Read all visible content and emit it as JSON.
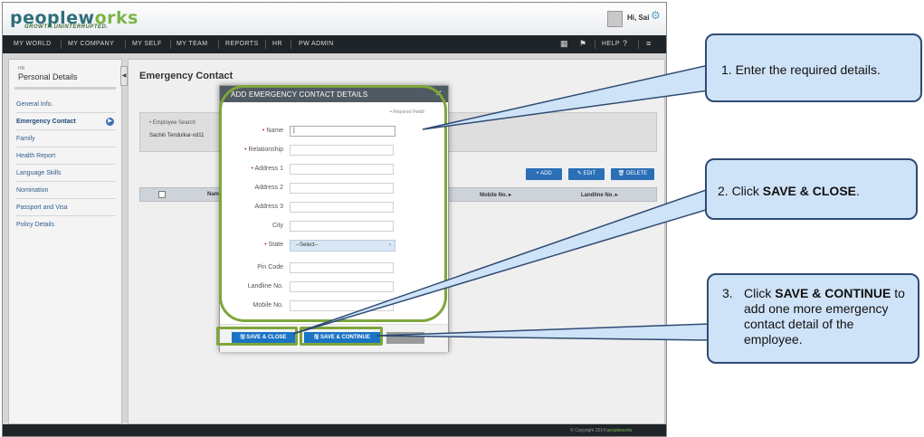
{
  "header": {
    "logo_main": "peoplew",
    "logo_accent": "orks",
    "tagline": "GROWTH.UNINTERRUPTED.",
    "greeting": "Hi, Sai"
  },
  "nav": {
    "items": [
      "MY WORLD",
      "MY COMPANY",
      "MY SELF",
      "MY TEAM",
      "REPORTS",
      "HR",
      "PW ADMIN"
    ],
    "help_label": "HELP"
  },
  "sidebar": {
    "section": "HR",
    "title": "Personal Details",
    "items": [
      "General Info.",
      "Emergency Contact",
      "Family",
      "Health Report",
      "Language Skills",
      "Nomination",
      "Passport and Visa",
      "Policy Details"
    ],
    "active_index": 1
  },
  "main": {
    "title": "Emergency Contact",
    "search_label": "Employee Search",
    "search_value": "Sachin Tendulkar-xd11",
    "buttons": {
      "add": "ADD",
      "edit": "EDIT",
      "delete": "DELETE"
    },
    "columns": [
      "Nam",
      "Mobile No.",
      "Landline No."
    ]
  },
  "modal": {
    "title": "ADD EMERGENCY CONTACT DETAILS",
    "required_note": "Required Fields",
    "fields": [
      {
        "label": "Name",
        "required": true,
        "value": "|"
      },
      {
        "label": "Relationship",
        "required": true,
        "value": ""
      },
      {
        "label": "Address 1",
        "required": true,
        "value": ""
      },
      {
        "label": "Address 2",
        "required": false,
        "value": ""
      },
      {
        "label": "Address 3",
        "required": false,
        "value": ""
      },
      {
        "label": "City",
        "required": false,
        "value": ""
      },
      {
        "label": "State",
        "required": true,
        "value": "--Select--",
        "type": "select"
      },
      {
        "label": "Pin Code",
        "required": false,
        "value": ""
      },
      {
        "label": "Landline No.",
        "required": false,
        "value": ""
      },
      {
        "label": "Mobile No.",
        "required": false,
        "value": ""
      }
    ],
    "save_close": "SAVE & CLOSE",
    "save_continue": "SAVE & CONTINUE"
  },
  "callouts": {
    "c1": "1. Enter the required details.",
    "c2_pre": "2.  Click ",
    "c2_bold": "SAVE & CLOSE",
    "c2_post": ".",
    "c3_num": "3.",
    "c3_pre": "Click ",
    "c3_bold": "SAVE & CONTINUE",
    "c3_post": " to add one more emergency contact detail of the employee."
  },
  "footer": {
    "copyright": "© Copyright 2014",
    "brand": "peopleworks"
  },
  "colors": {
    "accent_blue": "#1a74c4",
    "highlight_green": "#7ea63a",
    "callout_fill": "#cfe3f8",
    "callout_border": "#2e4b72",
    "nav_dark": "#1f2428"
  }
}
